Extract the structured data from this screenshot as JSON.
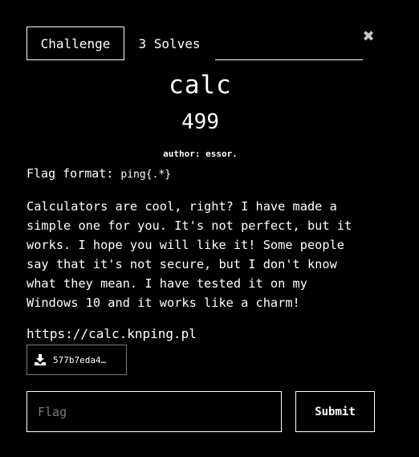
{
  "tabs": {
    "challenge_label": "Challenge",
    "solves_label": "3 Solves"
  },
  "close_icon": {
    "name": "close-icon",
    "glyph": "✖"
  },
  "challenge": {
    "name": "calc",
    "points": "499",
    "author": "author: essor.",
    "flag_format_label": "Flag format:",
    "flag_format_value": "ping{.*}",
    "description_lines": [
      "Calculators are cool, right? I have made a",
      "simple one for you. It's not perfect, but it",
      "works. I hope you will like it! Some people",
      "say that it's not secure, but I don't know",
      "what they mean. I have tested it on my",
      "Windows 10 and it works like a charm!"
    ],
    "link": "https://calc.knping.pl",
    "file": {
      "icon": "download-icon",
      "name": "577b7eda4…"
    }
  },
  "submission": {
    "flag_placeholder": "Flag",
    "flag_value": "",
    "submit_label": "Submit"
  },
  "colors": {
    "background": "#000000",
    "foreground": "#ffffff",
    "muted_border": "#7a7a7a",
    "placeholder": "#7a7a7a"
  }
}
